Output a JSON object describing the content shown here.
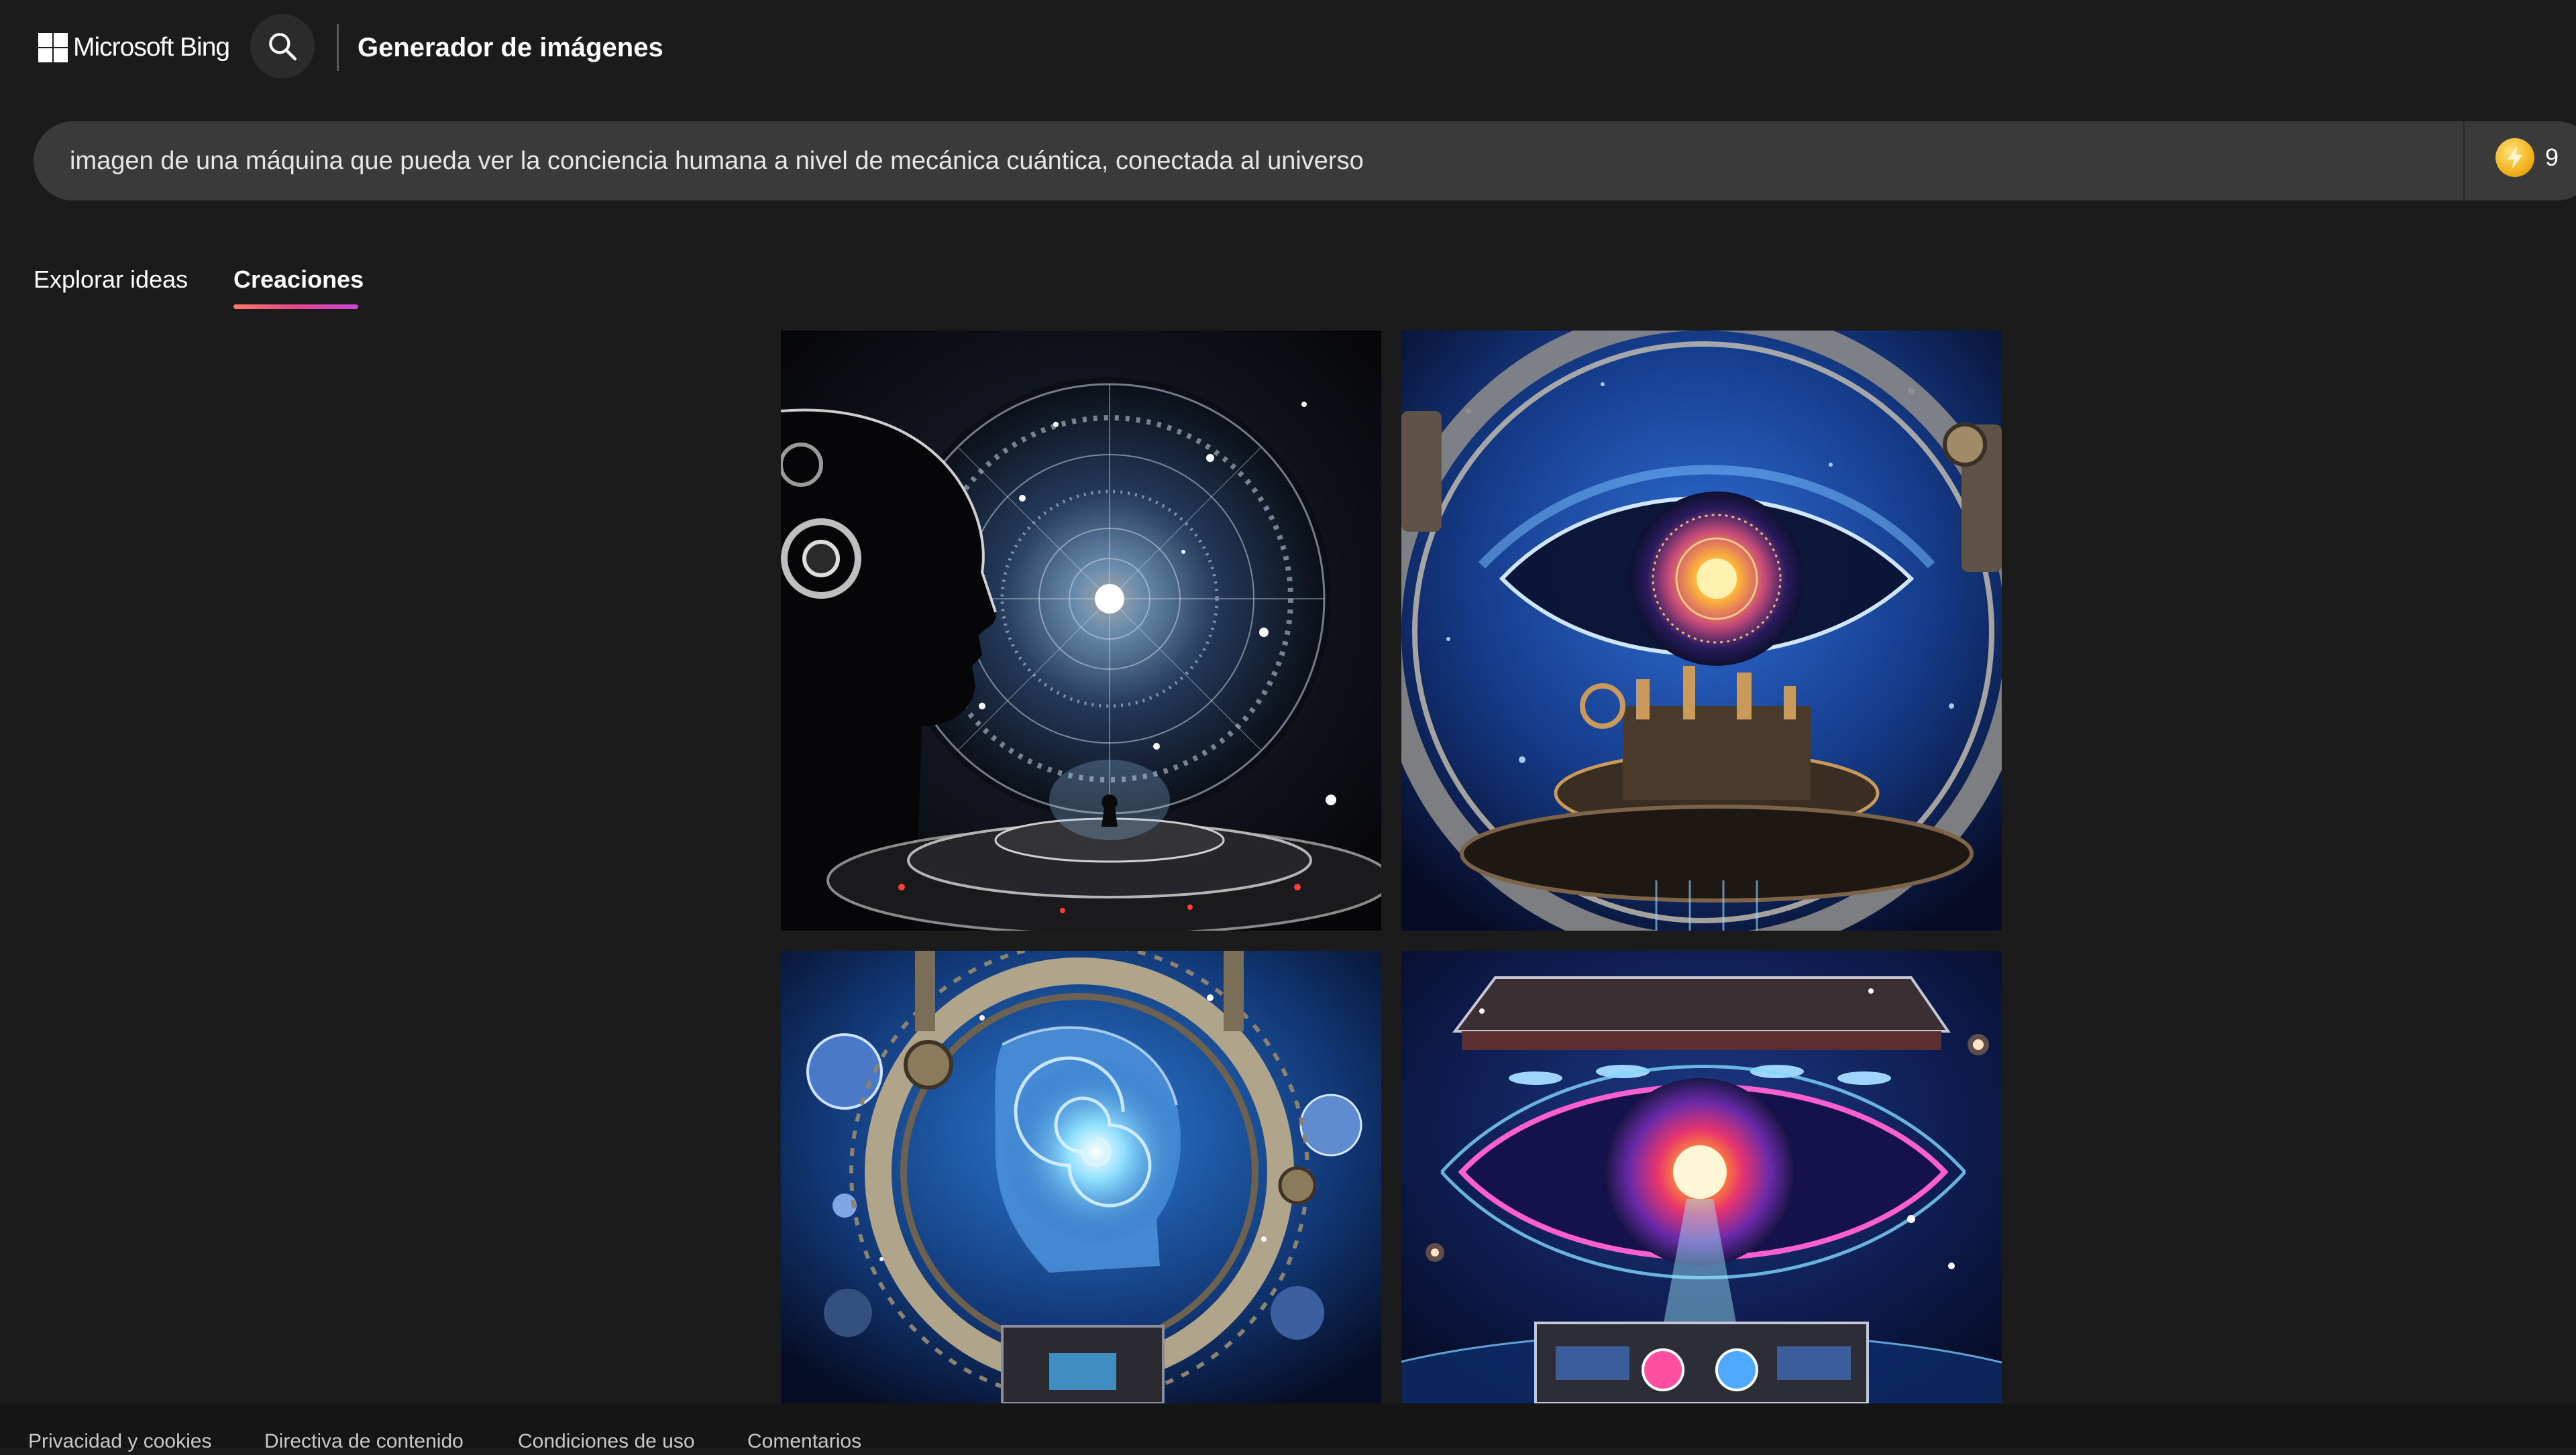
{
  "header": {
    "brand": "Microsoft Bing",
    "app_title": "Generador de imágenes",
    "search_icon": "search-icon"
  },
  "prompt": {
    "value": "imagen de una máquina que pueda ver la conciencia humana a nivel de mecánica cuántica, conectada al universo",
    "boost_icon": "lightning-coin-icon",
    "boost_count": "9",
    "boost_color": "#f2b21f"
  },
  "tabs": [
    {
      "label": "Explorar ideas",
      "active": false
    },
    {
      "label": "Creaciones",
      "active": true
    }
  ],
  "images": [
    {
      "name": "generated-image-1",
      "subject": "head-profile-cosmic-mandala"
    },
    {
      "name": "generated-image-2",
      "subject": "cosmic-eye-machine"
    },
    {
      "name": "generated-image-3",
      "subject": "spiral-head-portal"
    },
    {
      "name": "generated-image-4",
      "subject": "neon-eye-device"
    }
  ],
  "footer": {
    "links": [
      "Privacidad y cookies",
      "Directiva de contenido",
      "Condiciones de uso",
      "Comentarios"
    ]
  },
  "colors": {
    "background": "#1b1b1b",
    "prompt_bar": "#3a3a3a",
    "tab_underline": [
      "#ff7b6b",
      "#e8458b",
      "#c847d6"
    ]
  }
}
